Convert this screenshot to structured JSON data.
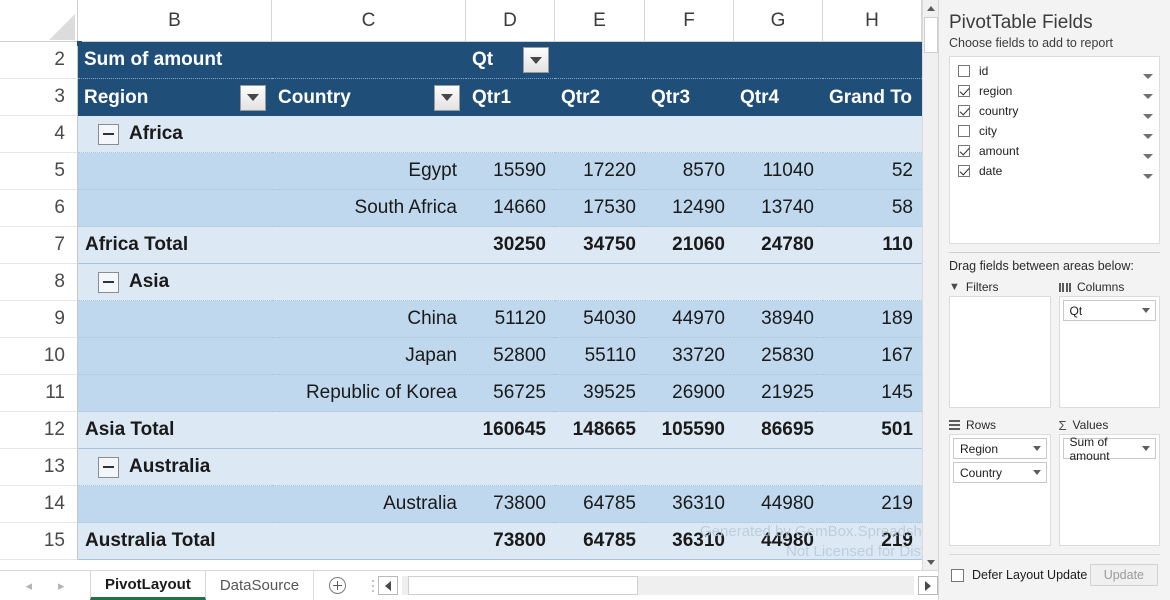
{
  "sheet": {
    "column_headers": [
      "B",
      "C",
      "D",
      "E",
      "F",
      "G",
      "H"
    ],
    "row_numbers": [
      "2",
      "3",
      "4",
      "5",
      "6",
      "7",
      "8",
      "9",
      "10",
      "11",
      "12",
      "13",
      "14",
      "15"
    ],
    "pivot_title": "Sum of amount",
    "column_field_label": "Qt",
    "row_header_region": "Region",
    "row_header_country": "Country",
    "value_headers": [
      "Qtr1",
      "Qtr2",
      "Qtr3",
      "Qtr4",
      "Grand To"
    ],
    "watermark_line1": "Generated by GemBox.Spreadsheet evaluation",
    "watermark_line2": "Not Licensed for Distri",
    "rows": [
      {
        "num": "4",
        "type": "region",
        "region": "Africa",
        "country": "",
        "values": [
          "",
          "",
          "",
          "",
          ""
        ]
      },
      {
        "num": "5",
        "type": "country",
        "region": "",
        "country": "Egypt",
        "values": [
          "15590",
          "17220",
          "8570",
          "11040",
          "52"
        ]
      },
      {
        "num": "6",
        "type": "country",
        "region": "",
        "country": "South Africa",
        "values": [
          "14660",
          "17530",
          "12490",
          "13740",
          "58"
        ]
      },
      {
        "num": "7",
        "type": "total",
        "region": "Africa Total",
        "country": "",
        "values": [
          "30250",
          "34750",
          "21060",
          "24780",
          "110"
        ]
      },
      {
        "num": "8",
        "type": "region",
        "region": "Asia",
        "country": "",
        "values": [
          "",
          "",
          "",
          "",
          ""
        ]
      },
      {
        "num": "9",
        "type": "country",
        "region": "",
        "country": "China",
        "values": [
          "51120",
          "54030",
          "44970",
          "38940",
          "189"
        ]
      },
      {
        "num": "10",
        "type": "country",
        "region": "",
        "country": "Japan",
        "values": [
          "52800",
          "55110",
          "33720",
          "25830",
          "167"
        ]
      },
      {
        "num": "11",
        "type": "country",
        "region": "",
        "country": "Republic of Korea",
        "values": [
          "56725",
          "39525",
          "26900",
          "21925",
          "145"
        ]
      },
      {
        "num": "12",
        "type": "total",
        "region": "Asia Total",
        "country": "",
        "values": [
          "160645",
          "148665",
          "105590",
          "86695",
          "501"
        ]
      },
      {
        "num": "13",
        "type": "region",
        "region": "Australia",
        "country": "",
        "values": [
          "",
          "",
          "",
          "",
          ""
        ]
      },
      {
        "num": "14",
        "type": "country",
        "region": "",
        "country": "Australia",
        "values": [
          "73800",
          "64785",
          "36310",
          "44980",
          "219"
        ]
      },
      {
        "num": "15",
        "type": "total",
        "region": "Australia Total",
        "country": "",
        "values": [
          "73800",
          "64785",
          "36310",
          "44980",
          "219"
        ]
      }
    ]
  },
  "tabs": {
    "sheets": [
      {
        "label": "PivotLayout",
        "active": true
      },
      {
        "label": "DataSource",
        "active": false
      }
    ],
    "add_icon": "plus-circle-icon",
    "prev_icon": "nav-prev-icon",
    "next_icon": "nav-next-icon"
  },
  "pane": {
    "title": "PivotTable Fields",
    "subtitle": "Choose fields to add to report",
    "fields": [
      {
        "name": "id",
        "checked": false
      },
      {
        "name": "region",
        "checked": true
      },
      {
        "name": "country",
        "checked": true
      },
      {
        "name": "city",
        "checked": false
      },
      {
        "name": "amount",
        "checked": true
      },
      {
        "name": "date",
        "checked": true
      }
    ],
    "drag_label": "Drag fields between areas below:",
    "areas": {
      "filters": {
        "label": "Filters",
        "icon": "filter-icon",
        "chips": []
      },
      "columns": {
        "label": "Columns",
        "icon": "columns-icon",
        "chips": [
          "Qt"
        ]
      },
      "rows": {
        "label": "Rows",
        "icon": "rows-icon",
        "chips": [
          "Region",
          "Country"
        ]
      },
      "values": {
        "label": "Values",
        "icon": "sigma-icon",
        "chips": [
          "Sum of amount"
        ]
      }
    },
    "defer_label": "Defer Layout Update",
    "defer_checked": false,
    "update_button": "Update"
  },
  "colors": {
    "pivot_header_bg": "#1F4E79",
    "band_light": "#DCE9F5",
    "band_mid": "#BFD8ED",
    "tab_accent": "#217346",
    "pane_bg": "#f3f3f3"
  }
}
